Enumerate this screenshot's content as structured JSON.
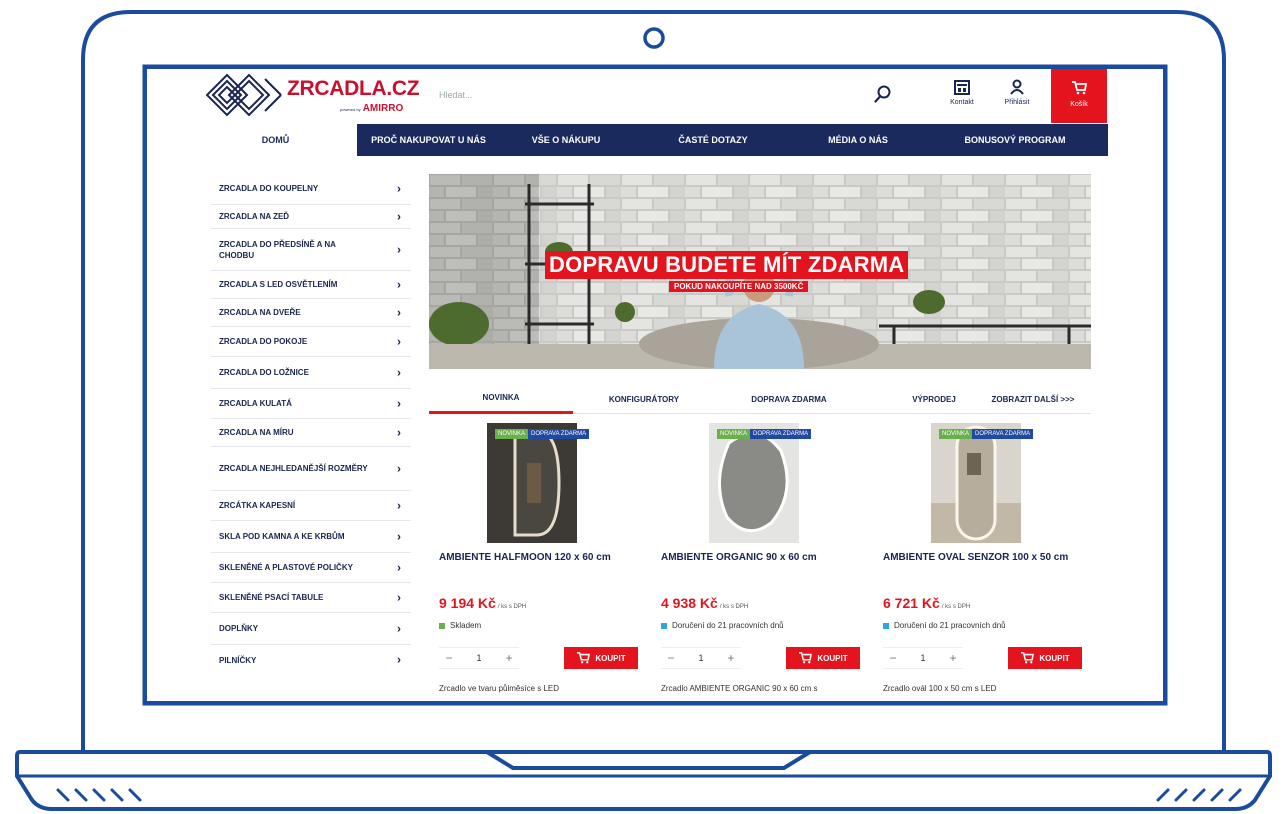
{
  "header": {
    "logo_text": "ZRCADLA.CZ",
    "logo_powered": "powered by",
    "logo_brand": "AMIRRO",
    "search_placeholder": "Hledat...",
    "contact_label": "Kontakt",
    "login_label": "Přihlásit",
    "cart_label": "Košík"
  },
  "nav": {
    "items": [
      "DOMŮ",
      "PROČ NAKUPOVAT U NÁS",
      "VŠE O NÁKUPU",
      "ČASTÉ DOTAZY",
      "MÉDIA O NÁS",
      "BONUSOVÝ PROGRAM"
    ],
    "active_index": 0
  },
  "sidebar": {
    "items": [
      "ZRCADLA DO KOUPELNY",
      "ZRCADLA NA ZEĎ",
      "ZRCADLA DO PŘEDSÍNĚ A NA CHODBU",
      "ZRCADLA S LED OSVĚTLENÍM",
      "ZRCADLA NA DVEŘE",
      "ZRCADLA DO POKOJE",
      "ZRCADLA DO LOŽNICE",
      "ZRCADLA KULATÁ",
      "ZRCADLA NA MÍRU",
      "ZRCADLA NEJHLEDANĚJŠÍ ROZMĚRY",
      "ZRCÁTKA KAPESNÍ",
      "SKLA POD KAMNA A KE KRBŮM",
      "SKLENĚNÉ A PLASTOVÉ POLIČKY",
      "SKLENĚNÉ PSACÍ TABULE",
      "DOPLŇKY",
      "PILNÍČKY"
    ],
    "chevron": "›"
  },
  "banner": {
    "title": "DOPRAVU BUDETE MÍT ZDARMA",
    "subtitle": "POKUD NAKOUPÍTE NAD 3500KČ"
  },
  "tabs": {
    "items": [
      "NOVINKA",
      "KONFIGURÁTORY",
      "DOPRAVA ZDARMA",
      "VÝPRODEJ"
    ],
    "more": "ZOBRAZIT DALŠÍ >>>",
    "active_index": 0
  },
  "products": [
    {
      "badge_new": "NOVINKA",
      "badge_ship": "DOPRAVA ZDARMA",
      "name": "AMBIENTE HALFMOON 120 x 60 cm",
      "price": "9 194 Kč",
      "price_unit": "/ ks s DPH",
      "availability": "Skladem",
      "availability_color": "#6ab04c",
      "qty": "1",
      "buy_label": "KOUPIT",
      "description": "Zrcadlo ve tvaru půlměsíce s LED"
    },
    {
      "badge_new": "NOVINKA",
      "badge_ship": "DOPRAVA ZDARMA",
      "name": "AMBIENTE ORGANIC 90 x 60 cm",
      "price": "4 938 Kč",
      "price_unit": "/ ks s DPH",
      "availability": "Doručení do 21 pracovních dnů",
      "availability_color": "#2aa8e0",
      "qty": "1",
      "buy_label": "KOUPIT",
      "description": "Zrcadlo AMBIENTE ORGANIC 90 x 60 cm s"
    },
    {
      "badge_new": "NOVINKA",
      "badge_ship": "DOPRAVA ZDARMA",
      "name": "AMBIENTE OVAL SENZOR 100 x 50 cm",
      "price": "6 721 Kč",
      "price_unit": "/ ks s DPH",
      "availability": "Doručení do 21 pracovních dnů",
      "availability_color": "#2aa8e0",
      "qty": "1",
      "buy_label": "KOUPIT",
      "description": "Zrcadlo ovál 100 x 50 cm s LED"
    }
  ],
  "qty_controls": {
    "minus": "−",
    "plus": "+"
  },
  "colors": {
    "laptop_outline": "#1b4b9c",
    "nav_bg": "#1b2a5c",
    "accent_red": "#e3141e",
    "badge_green": "#6ab04c",
    "badge_blue": "#1f4aa0"
  }
}
